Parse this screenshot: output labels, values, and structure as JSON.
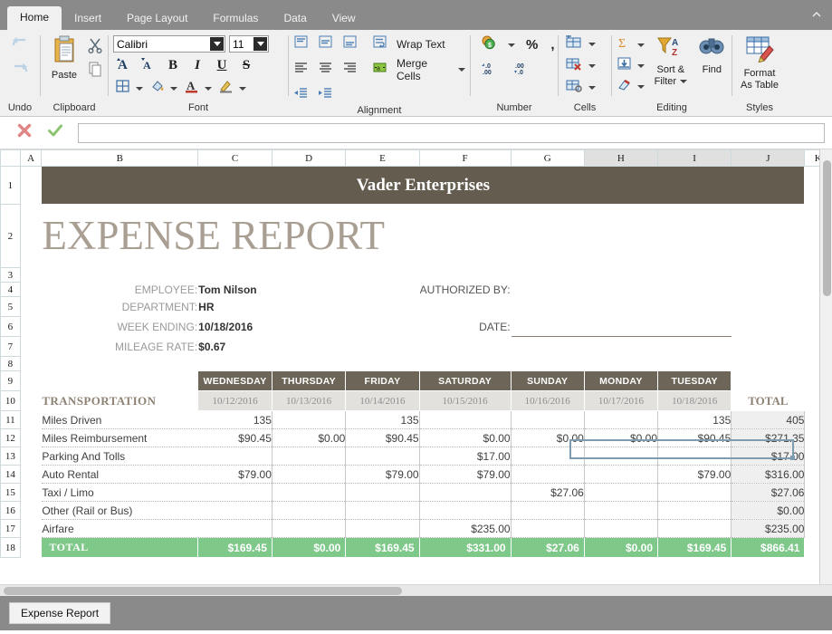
{
  "ribbon": {
    "tabs": [
      {
        "label": "Home",
        "active": true
      },
      {
        "label": "Insert",
        "active": false
      },
      {
        "label": "Page Layout",
        "active": false
      },
      {
        "label": "Formulas",
        "active": false
      },
      {
        "label": "Data",
        "active": false
      },
      {
        "label": "View",
        "active": false
      }
    ],
    "groups": {
      "undo": {
        "label": "Undo"
      },
      "clipboard": {
        "label": "Clipboard",
        "paste": "Paste"
      },
      "font": {
        "label": "Font",
        "font_name": "Calibri",
        "font_size": "11",
        "bold": "B",
        "italic": "I",
        "underline": "U",
        "strikethrough": "S"
      },
      "alignment": {
        "label": "Alignment",
        "wrap_text": "Wrap Text",
        "merge_cells": "Merge Cells"
      },
      "number": {
        "label": "Number",
        "percent": "%",
        "comma": ","
      },
      "cells": {
        "label": "Cells"
      },
      "editing": {
        "label": "Editing",
        "sort_filter_line1": "Sort &",
        "sort_filter_line2": "Filter",
        "find": "Find"
      },
      "styles": {
        "label": "Styles",
        "format_as_table_line1": "Format",
        "format_as_table_line2": "As Table"
      }
    }
  },
  "formula_bar": {
    "value": "",
    "cancel_icon": "cancel-icon",
    "confirm_icon": "confirm-icon"
  },
  "grid": {
    "columns": [
      "A",
      "B",
      "C",
      "D",
      "E",
      "F",
      "G",
      "H",
      "I",
      "J",
      "K"
    ],
    "selected_columns": [
      "H",
      "I",
      "J"
    ],
    "rows": [
      "1",
      "2",
      "3",
      "4",
      "5",
      "6",
      "7",
      "8",
      "9",
      "10",
      "11",
      "12",
      "13",
      "14",
      "15",
      "16",
      "17",
      "18"
    ]
  },
  "report": {
    "company": "Vader Enterprises",
    "title": "EXPENSE REPORT",
    "fields": [
      {
        "label": "EMPLOYEE:",
        "value": "Tom Nilson"
      },
      {
        "label": "DEPARTMENT:",
        "value": "HR"
      },
      {
        "label": "WEEK ENDING:",
        "value": "10/18/2016"
      },
      {
        "label": "MILEAGE RATE:",
        "value": "$0.67"
      }
    ],
    "authorized_by_label": "AUTHORIZED BY:",
    "authorized_by_value": "",
    "date_label": "DATE:",
    "date_value": ""
  },
  "table": {
    "section_label": "TRANSPORTATION",
    "total_column_label": "TOTAL",
    "day_headers": [
      "WEDNESDAY",
      "THURSDAY",
      "FRIDAY",
      "SATURDAY",
      "SUNDAY",
      "MONDAY",
      "TUESDAY"
    ],
    "date_headers": [
      "10/12/2016",
      "10/13/2016",
      "10/14/2016",
      "10/15/2016",
      "10/16/2016",
      "10/17/2016",
      "10/18/2016"
    ],
    "rows": [
      {
        "name": "Miles Driven",
        "values": [
          "135",
          "",
          "135",
          "",
          "",
          "",
          "135"
        ],
        "total": "405"
      },
      {
        "name": "Miles Reimbursement",
        "values": [
          "$90.45",
          "$0.00",
          "$90.45",
          "$0.00",
          "$0.00",
          "$0.00",
          "$90.45"
        ],
        "total": "$271.35"
      },
      {
        "name": "Parking And Tolls",
        "values": [
          "",
          "",
          "",
          "$17.00",
          "",
          "",
          ""
        ],
        "total": "$17.00"
      },
      {
        "name": "Auto Rental",
        "values": [
          "$79.00",
          "",
          "$79.00",
          "$79.00",
          "",
          "",
          "$79.00"
        ],
        "total": "$316.00"
      },
      {
        "name": "Taxi / Limo",
        "values": [
          "",
          "",
          "",
          "",
          "$27.06",
          "",
          ""
        ],
        "total": "$27.06"
      },
      {
        "name": "Other (Rail or Bus)",
        "values": [
          "",
          "",
          "",
          "",
          "",
          "",
          ""
        ],
        "total": "$0.00"
      },
      {
        "name": "Airfare",
        "values": [
          "",
          "",
          "",
          "$235.00",
          "",
          "",
          ""
        ],
        "total": "$235.00"
      }
    ],
    "grand_total": {
      "label": "TOTAL",
      "values": [
        "$169.45",
        "$0.00",
        "$169.45",
        "$331.00",
        "$27.06",
        "$0.00",
        "$169.45"
      ],
      "total": "$866.41"
    }
  },
  "sheet_tabs": [
    {
      "label": "Expense Report",
      "active": true
    }
  ],
  "colors": {
    "banner": "#635c4f",
    "title_text": "#a99e92",
    "day_header": "#6d6557",
    "date_header": "#e3e1dd",
    "grand_total": "#7ec88a",
    "selection": "#7e9cb0"
  }
}
